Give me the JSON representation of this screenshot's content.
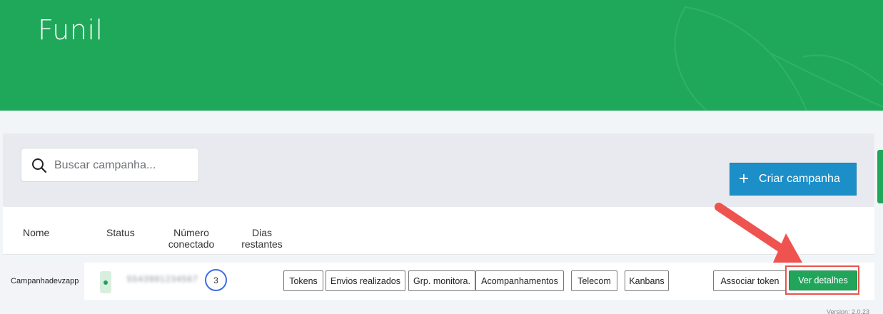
{
  "header": {
    "title": "Funil"
  },
  "search": {
    "placeholder": "Buscar campanha..."
  },
  "toolbar": {
    "create_label": "Criar campanha",
    "create_icon": "plus-icon"
  },
  "table": {
    "columns": {
      "name": "Nome",
      "status": "Status",
      "number_line1": "Número",
      "number_line2": "conectado",
      "days_line1": "Dias",
      "days_line2": "restantes"
    },
    "rows": [
      {
        "name": "Campanhadevzapp",
        "status": "connected",
        "number": "5543991234567",
        "count": "3",
        "actions": {
          "tokens": "Tokens",
          "sent": "Envios realizados",
          "groups": "Grp. monitora.",
          "followups": "Acompanhamentos",
          "telecom": "Telecom",
          "kanbans": "Kanbans",
          "associate": "Associar token",
          "details": "Ver detalhes"
        }
      }
    ]
  },
  "footer": {
    "version": "Version: 2.0.23"
  },
  "colors": {
    "brand": "#20a85a",
    "primary": "#1c8fc9",
    "highlight": "#e8544e"
  }
}
